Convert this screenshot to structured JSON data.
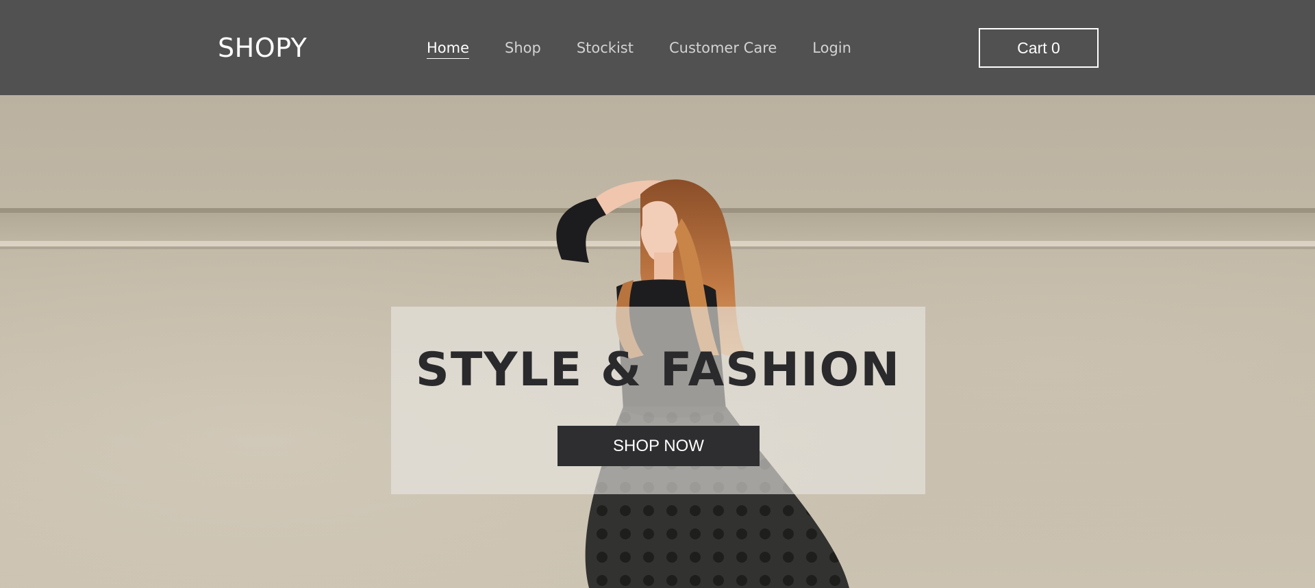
{
  "header": {
    "logo": "SHOPY",
    "nav": [
      {
        "label": "Home",
        "active": true
      },
      {
        "label": "Shop",
        "active": false
      },
      {
        "label": "Stockist",
        "active": false
      },
      {
        "label": "Customer Care",
        "active": false
      },
      {
        "label": "Login",
        "active": false
      }
    ],
    "cart_label": "Cart 0"
  },
  "hero": {
    "title": "STYLE & FASHION",
    "cta_label": "SHOP NOW",
    "image": "woman-in-black-dress-against-concrete-wall"
  },
  "colors": {
    "header_bg": "#525152",
    "nav_text": "#d3d3d3",
    "nav_active": "#ffffff",
    "hero_wall": "#c2b8a6",
    "title_text": "#2a2a2c",
    "cta_bg": "#2e2e30",
    "cta_text": "#ffffff"
  }
}
